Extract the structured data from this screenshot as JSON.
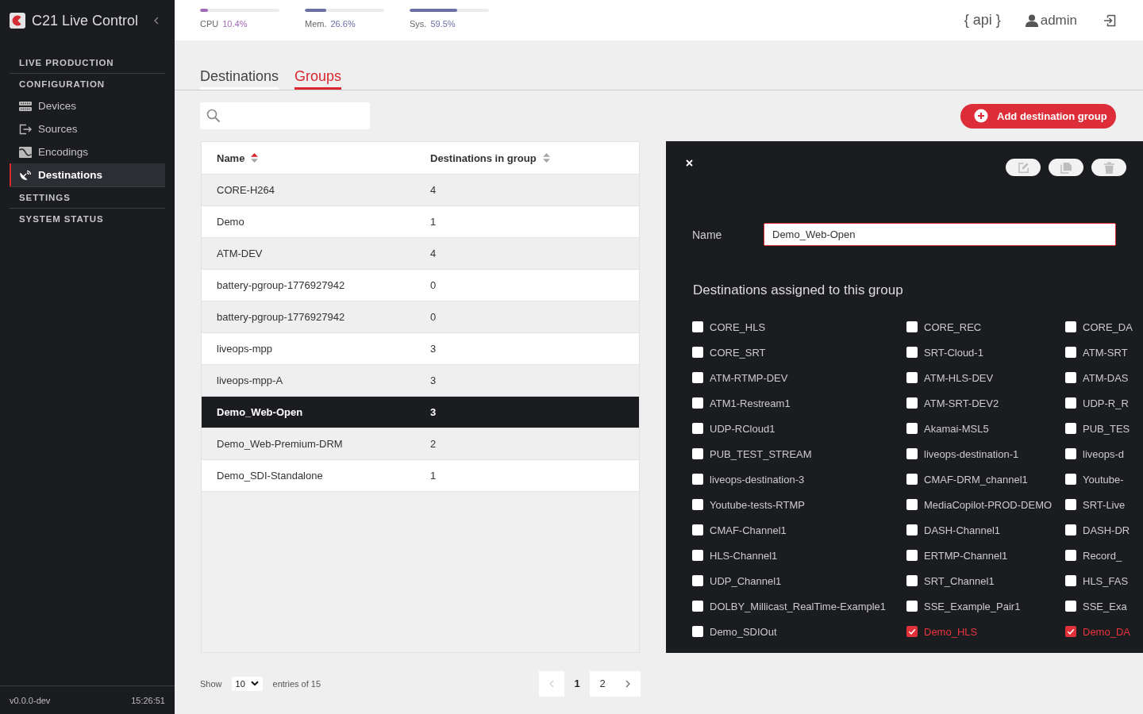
{
  "sidebar": {
    "app_title": "C21 Live Control",
    "sections": [
      {
        "label": "LIVE PRODUCTION"
      },
      {
        "label": "CONFIGURATION",
        "items": [
          {
            "label": "Devices",
            "selected": false
          },
          {
            "label": "Sources",
            "selected": false
          },
          {
            "label": "Encodings",
            "selected": false
          },
          {
            "label": "Destinations",
            "selected": true
          }
        ]
      },
      {
        "label": "SETTINGS"
      },
      {
        "label": "SYSTEM STATUS"
      }
    ],
    "version": "v0.0.0-dev",
    "clock": "15:26:51"
  },
  "top_bar": {
    "meters": [
      {
        "label": "CPU",
        "reading": "10.4%",
        "level": 0.104,
        "color": "#a36cb8"
      },
      {
        "label": "Mem.",
        "reading": "26.6%",
        "level": 0.266,
        "color": "#6a6fa6"
      },
      {
        "label": "Sys.",
        "reading": "59.5%",
        "level": 0.595,
        "color": "#6a6fa6"
      }
    ],
    "api_link": "{ api }",
    "user": "admin"
  },
  "tabs": [
    {
      "label": "Destinations",
      "selected": false
    },
    {
      "label": "Groups",
      "selected": true
    }
  ],
  "toolbar": {
    "add_button": "Add destination group"
  },
  "table": {
    "columns": [
      {
        "label": "Name",
        "sorted": true
      },
      {
        "label": "Destinations in group",
        "sorted": false
      }
    ],
    "rows": [
      {
        "name": "CORE-H264",
        "count": "4",
        "selected": false
      },
      {
        "name": "Demo",
        "count": "1",
        "selected": false
      },
      {
        "name": "ATM-DEV",
        "count": "4",
        "selected": false
      },
      {
        "name": "battery-pgroup-1776927942",
        "count": "0",
        "selected": false
      },
      {
        "name": "battery-pgroup-1776927942",
        "count": "0",
        "selected": false
      },
      {
        "name": "liveops-mpp",
        "count": "3",
        "selected": false
      },
      {
        "name": "liveops-mpp-A",
        "count": "3",
        "selected": false
      },
      {
        "name": "Demo_Web-Open",
        "count": "3",
        "selected": true
      },
      {
        "name": "Demo_Web-Premium-DRM",
        "count": "2",
        "selected": false
      },
      {
        "name": "Demo_SDI-Standalone",
        "count": "1",
        "selected": false
      }
    ]
  },
  "pagination": {
    "show_label": "Show",
    "page_size": "10",
    "entries_text": "entries of 15",
    "previous_disabled": true,
    "next_disabled": false,
    "pages": [
      {
        "label": "1",
        "selected": true
      },
      {
        "label": "2",
        "selected": false
      }
    ]
  },
  "detail_panel": {
    "name_label": "Name",
    "name_value": "Demo_Web-Open",
    "assigned_title": "Destinations assigned to this group",
    "destinations": [
      {
        "label": "CORE_HLS",
        "checked": false
      },
      {
        "label": "CORE_REC",
        "checked": false
      },
      {
        "label": "CORE_DA",
        "checked": false
      },
      {
        "label": "CORE_SRT",
        "checked": false
      },
      {
        "label": "SRT-Cloud-1",
        "checked": false
      },
      {
        "label": "ATM-SRT",
        "checked": false
      },
      {
        "label": "ATM-RTMP-DEV",
        "checked": false
      },
      {
        "label": "ATM-HLS-DEV",
        "checked": false
      },
      {
        "label": "ATM-DAS",
        "checked": false
      },
      {
        "label": "ATM1-Restream1",
        "checked": false
      },
      {
        "label": "ATM-SRT-DEV2",
        "checked": false
      },
      {
        "label": "UDP-R_R",
        "checked": false
      },
      {
        "label": "UDP-RCloud1",
        "checked": false
      },
      {
        "label": "Akamai-MSL5",
        "checked": false
      },
      {
        "label": "PUB_TES",
        "checked": false
      },
      {
        "label": "PUB_TEST_STREAM",
        "checked": false
      },
      {
        "label": "liveops-destination-1",
        "checked": false
      },
      {
        "label": "liveops-d",
        "checked": false
      },
      {
        "label": "liveops-destination-3",
        "checked": false
      },
      {
        "label": "CMAF-DRM_channel1",
        "checked": false
      },
      {
        "label": "Youtube-",
        "checked": false
      },
      {
        "label": "Youtube-tests-RTMP",
        "checked": false
      },
      {
        "label": "MediaCopilot-PROD-DEMO",
        "checked": false
      },
      {
        "label": "SRT-Live",
        "checked": false
      },
      {
        "label": "CMAF-Channel1",
        "checked": false
      },
      {
        "label": "DASH-Channel1",
        "checked": false
      },
      {
        "label": "DASH-DR",
        "checked": false
      },
      {
        "label": "HLS-Channel1",
        "checked": false
      },
      {
        "label": "ERTMP-Channel1",
        "checked": false
      },
      {
        "label": "Record_",
        "checked": false
      },
      {
        "label": "UDP_Channel1",
        "checked": false
      },
      {
        "label": "SRT_Channel1",
        "checked": false
      },
      {
        "label": "HLS_FAS",
        "checked": false
      },
      {
        "label": "DOLBY_Millicast_RealTime-Example1",
        "checked": false
      },
      {
        "label": "SSE_Example_Pair1",
        "checked": false
      },
      {
        "label": "SSE_Exa",
        "checked": false
      },
      {
        "label": "Demo_SDIOut",
        "checked": false
      },
      {
        "label": "Demo_HLS",
        "checked": true
      },
      {
        "label": "Demo_DA",
        "checked": true
      }
    ]
  }
}
